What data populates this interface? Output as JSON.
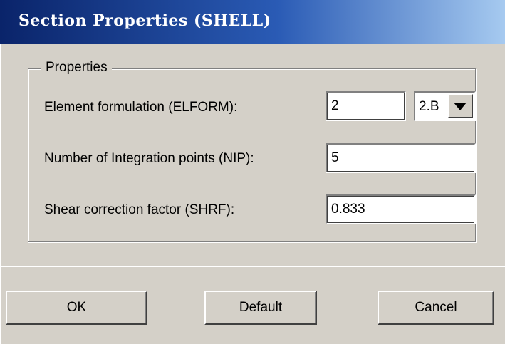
{
  "window": {
    "title": "Section Properties (SHELL)"
  },
  "properties": {
    "legend": "Properties",
    "rows": [
      {
        "label": "Element formulation (ELFORM):",
        "value": "2"
      },
      {
        "label": "Number of Integration points (NIP):",
        "value": "5"
      },
      {
        "label": "Shear correction factor (SHRF):",
        "value": "0.833"
      }
    ],
    "elform_combo": {
      "selected": "2.B",
      "icon": "dropdown-arrow-icon"
    }
  },
  "buttons": {
    "ok": "OK",
    "default": "Default",
    "cancel": "Cancel"
  },
  "colors": {
    "titlebar_start": "#0a246a",
    "titlebar_end": "#a6caf0",
    "dialog_bg": "#d4d0c8"
  }
}
